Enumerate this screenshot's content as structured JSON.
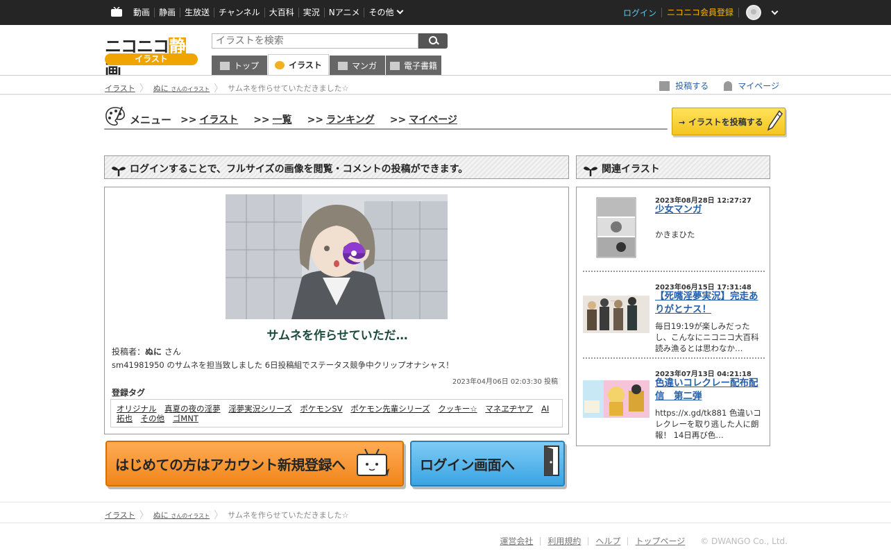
{
  "topnav": {
    "items": [
      "動画",
      "静画",
      "生放送",
      "チャンネル",
      "大百科",
      "実況",
      "Nアニメ",
      "その他"
    ],
    "login": "ログイン",
    "register": "ニコニコ会員登録"
  },
  "header": {
    "logo_text": "ニコニコ",
    "logo_accent": "静",
    "logo_text2": "画",
    "logo_sub": "イラスト",
    "search_placeholder": "イラストを検索",
    "tabs": [
      "トップ",
      "イラスト",
      "マンガ",
      "電子書籍"
    ]
  },
  "breadcrumb": {
    "root": "イラスト",
    "user": "ぬに",
    "user_suffix": "さんのイラスト",
    "current": "サムネを作らせていただきました☆"
  },
  "actions": {
    "post": "投稿する",
    "mypage": "マイページ"
  },
  "menu": {
    "title": "メニュー",
    "arrow": ">>",
    "links": [
      "イラスト",
      "一覧",
      "ランキング",
      "マイページ"
    ],
    "post_banner": "イラストを投稿する",
    "post_arrow": "→"
  },
  "main": {
    "section_title": "ログインすることで、フルサイズの画像を閲覧・コメントの投稿ができます。",
    "work_title": "サムネを作らせていただ…",
    "poster_label": "投稿者：",
    "poster_name": "ぬに",
    "poster_suffix": "さん",
    "description": "sm41981950 のサムネを担当致しました 6日投稿組でステータス競争中クリップオナシャス！",
    "posted_at": "2023年04月06日 02:03:30 投稿",
    "tags_title": "登録タグ",
    "tags": [
      "オリジナル",
      "真夏の夜の淫夢",
      "淫夢実況シリーズ",
      "ポケモンSV",
      "ポケモン先輩シリーズ",
      "クッキー☆",
      "マネヱヂヤア",
      "AI拓也",
      "その他",
      "ゴMNT"
    ]
  },
  "cta": {
    "register": "はじめての方はアカウント新規登録へ",
    "login": "ログイン画面へ"
  },
  "related": {
    "section_title": "関連イラスト",
    "items": [
      {
        "date": "2023年08月28日 12:27:27",
        "title": "少女マンガ",
        "desc": "かきまひた"
      },
      {
        "date": "2023年06月15日 17:31:48",
        "title": "【死嘴淫夢実況】完走ありがとナス！",
        "desc": "毎日19:19が楽しみだったし、こんなにニコニコ大百科読み漁るとは思わなか…"
      },
      {
        "date": "2023年07月13日 04:21:18",
        "title": "色違いコレクレー配布配信　第二弾",
        "desc": "https://x.gd/tk881 色違いコレクレーを取り逃した人に朗報！ 14日再び色…"
      }
    ]
  },
  "footer": {
    "links": [
      "運営会社",
      "利用規約",
      "ヘルプ",
      "トップページ"
    ],
    "copyright": "© DWANGO Co., Ltd."
  },
  "colors": {
    "topbar": "#252525",
    "accent": "#f0a400",
    "link": "#2560a8",
    "login": "#64c3f0",
    "register": "#f5b800"
  }
}
